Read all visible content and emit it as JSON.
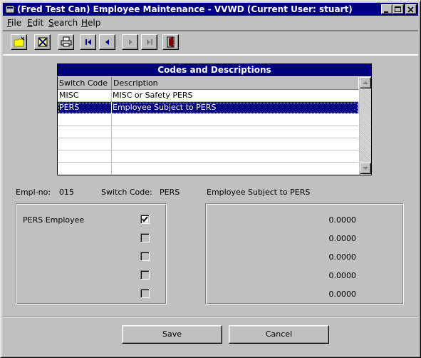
{
  "window": {
    "title": "(Fred Test Can) Employee Maintenance - VVWD (Current User: stuart)",
    "controls": [
      "minimize",
      "maximize",
      "close"
    ]
  },
  "menu": [
    {
      "label": "File",
      "mnemonic": "F",
      "rest": "ile"
    },
    {
      "label": "Edit",
      "mnemonic": "E",
      "rest": "dit"
    },
    {
      "label": "Search",
      "mnemonic": "S",
      "rest": "earch"
    },
    {
      "label": "Help",
      "mnemonic": "H",
      "rest": "elp"
    }
  ],
  "toolbar": [
    "new-icon",
    "delete-icon",
    "print-icon",
    "first-record-icon",
    "previous-record-icon",
    "next-record-icon",
    "last-record-icon",
    "exit-icon"
  ],
  "grid": {
    "title": "Codes and Descriptions",
    "columns": [
      "Switch Code",
      "Description"
    ],
    "rows": [
      {
        "code": "MISC",
        "description": "MISC or Safety PERS"
      },
      {
        "code": "PERS",
        "description": "Employee Subject to PERS"
      }
    ],
    "selected_row": 1
  },
  "info": {
    "empl_label": "Empl-no:",
    "empl_value": "015",
    "switch_label": "Switch Code:",
    "switch_value": "PERS",
    "description": "Employee Subject to PERS"
  },
  "flags": [
    {
      "label": "PERS Employee",
      "checked": true
    },
    {
      "label": "",
      "checked": false
    },
    {
      "label": "",
      "checked": false
    },
    {
      "label": "",
      "checked": false
    },
    {
      "label": "",
      "checked": false
    }
  ],
  "values": [
    "0.0000",
    "0.0000",
    "0.0000",
    "0.0000",
    "0.0000"
  ],
  "buttons": {
    "save": "Save",
    "cancel": "Cancel"
  }
}
